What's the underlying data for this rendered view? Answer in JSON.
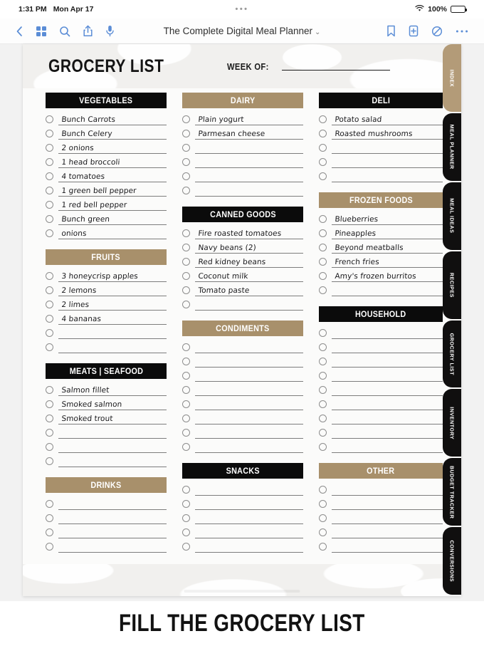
{
  "status_bar": {
    "time": "1:31 PM",
    "date": "Mon Apr 17",
    "center_dots": "•••",
    "battery_percent": "100%",
    "wifi_icon": "wifi-icon",
    "battery_icon": "battery-icon"
  },
  "toolbar": {
    "back_icon": "back-chevron-icon",
    "grid_icon": "thumbnails-grid-icon",
    "search_icon": "search-icon",
    "share_icon": "share-icon",
    "mic_icon": "microphone-icon",
    "title": "The Complete Digital Meal Planner",
    "title_chevron": "⌄",
    "bookmark_icon": "bookmark-icon",
    "add_page_icon": "add-page-icon",
    "markup_icon": "markup-pen-icon",
    "more_icon": "more-options-icon"
  },
  "page": {
    "title": "GROCERY LIST",
    "week_label": "WEEK OF:",
    "week_value": ""
  },
  "colors": {
    "dark": "#0b0b0b",
    "tan": "#a8906b",
    "tab_tan": "#b39b78",
    "accent_blue": "#5b8dd6",
    "paper": "#fbfbfa"
  },
  "columns": [
    {
      "sections": [
        {
          "title": "VEGETABLES",
          "style": "dark",
          "items": [
            "Bunch Carrots",
            "Bunch Celery",
            "2 onions",
            "1 head broccoli",
            "4 tomatoes",
            "1 green bell pepper",
            "1 red bell pepper",
            "Bunch green",
            "onions"
          ]
        },
        {
          "title": "FRUITS",
          "style": "tan",
          "items": [
            "3 honeycrisp apples",
            "2 lemons",
            "2 limes",
            "4 bananas",
            "",
            ""
          ]
        },
        {
          "title": "MEATS | SEAFOOD",
          "style": "dark",
          "items": [
            "Salmon fillet",
            "Smoked salmon",
            "Smoked trout",
            "",
            "",
            ""
          ]
        },
        {
          "title": "DRINKS",
          "style": "tan",
          "items": [
            "",
            "",
            "",
            ""
          ]
        }
      ]
    },
    {
      "sections": [
        {
          "title": "DAIRY",
          "style": "tan",
          "items": [
            "Plain yogurt",
            "Parmesan cheese",
            "",
            "",
            "",
            ""
          ]
        },
        {
          "title": "CANNED GOODS",
          "style": "dark",
          "items": [
            "Fire roasted tomatoes",
            "Navy beans (2)",
            "Red kidney beans",
            "Coconut milk",
            "Tomato paste",
            ""
          ]
        },
        {
          "title": "CONDIMENTS",
          "style": "tan",
          "items": [
            "",
            "",
            "",
            "",
            "",
            "",
            "",
            ""
          ]
        },
        {
          "title": "SNACKS",
          "style": "dark",
          "items": [
            "",
            "",
            "",
            "",
            ""
          ]
        }
      ]
    },
    {
      "sections": [
        {
          "title": "DELI",
          "style": "dark",
          "items": [
            "Potato salad",
            "Roasted mushrooms",
            "",
            "",
            ""
          ]
        },
        {
          "title": "FROZEN FOODS",
          "style": "tan",
          "items": [
            "Blueberries",
            "Pineapples",
            "Beyond meatballs",
            "French fries",
            "Amy's frozen burritos",
            ""
          ]
        },
        {
          "title": "HOUSEHOLD",
          "style": "dark",
          "items": [
            "",
            "",
            "",
            "",
            "",
            "",
            "",
            "",
            ""
          ]
        },
        {
          "title": "OTHER",
          "style": "tan",
          "items": [
            "",
            "",
            "",
            "",
            ""
          ]
        }
      ]
    }
  ],
  "side_tabs": [
    {
      "label": "INDEX",
      "style": "tan"
    },
    {
      "label": "MEAL PLANNER",
      "style": "dark"
    },
    {
      "label": "MEAL IDEAS",
      "style": "dark"
    },
    {
      "label": "RECIPES",
      "style": "dark"
    },
    {
      "label": "GROCERY LIST",
      "style": "dark"
    },
    {
      "label": "INVENTORY",
      "style": "dark"
    },
    {
      "label": "BUDGET TRACKER",
      "style": "dark"
    },
    {
      "label": "CONVERSIONS",
      "style": "dark"
    }
  ],
  "footer": {
    "caption": "FILL THE GROCERY LIST"
  }
}
